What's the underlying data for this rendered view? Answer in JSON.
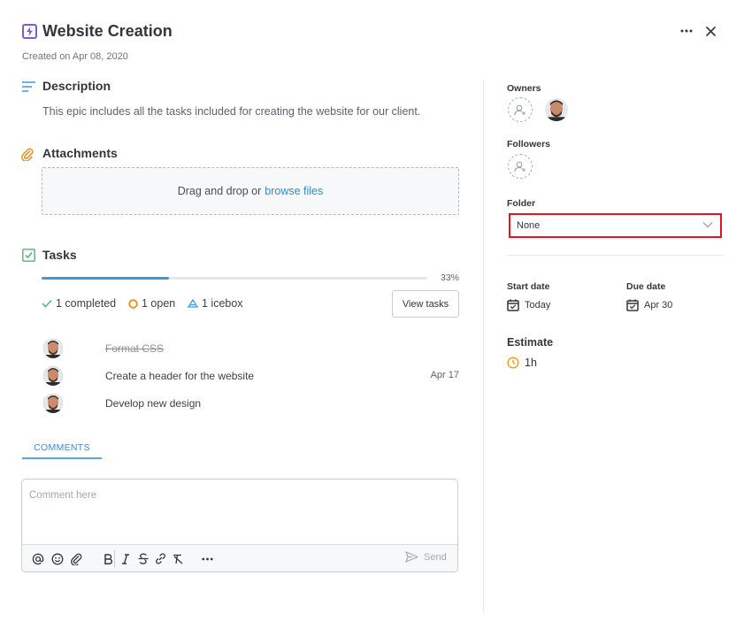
{
  "header": {
    "title": "Website Creation",
    "created": "Created on Apr 08, 2020",
    "title_icon": "lightning-icon",
    "accent_color": "#7b5bd6"
  },
  "description": {
    "heading": "Description",
    "text": "This epic includes all the tasks included for creating the website for our client."
  },
  "attachments": {
    "heading": "Attachments",
    "drop_text": "Drag and drop or",
    "browse_link": "browse files"
  },
  "tasks": {
    "heading": "Tasks",
    "progress_value": 33,
    "progress_label": "33%",
    "completed": "1 completed",
    "open": "1 open",
    "icebox": "1 icebox",
    "view_button": "View tasks",
    "items": [
      {
        "name": "Format CSS",
        "date": "",
        "done": true
      },
      {
        "name": "Create a header for the website",
        "date": "Apr 17",
        "done": false
      },
      {
        "name": "Develop new design",
        "date": "",
        "done": false
      }
    ]
  },
  "comments": {
    "tab_label": "COMMENTS",
    "placeholder": "Comment here",
    "send_label": "Send"
  },
  "sidebar": {
    "owners_label": "Owners",
    "followers_label": "Followers",
    "folder_label": "Folder",
    "folder_value": "None",
    "start_date_label": "Start date",
    "start_date_value": "Today",
    "due_date_label": "Due date",
    "due_date_value": "Apr 30",
    "estimate_label": "Estimate",
    "estimate_value": "1h"
  },
  "colors": {
    "link": "#2d8ad8",
    "progress": "#3a9ae0",
    "check_green": "#4cb86a",
    "open_orange": "#f08a1c",
    "icebox_blue": "#3a9ae0",
    "highlight_red": "#e0171f"
  }
}
